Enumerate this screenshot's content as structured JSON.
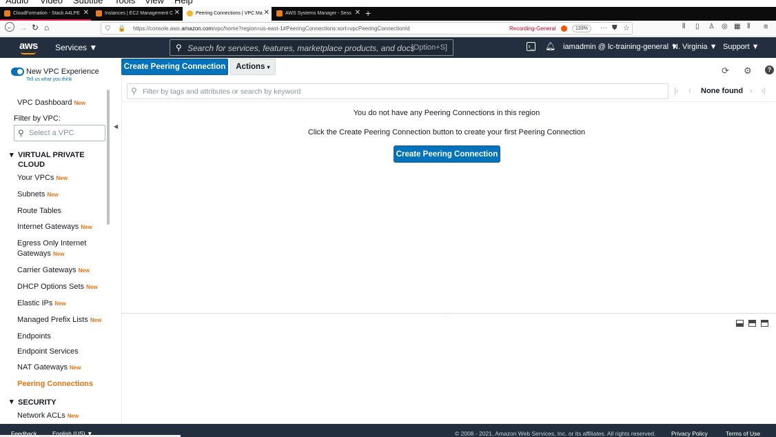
{
  "os_menu": [
    "Audio",
    "Video",
    "Subtitle",
    "Tools",
    "View",
    "Help"
  ],
  "browser": {
    "tabs": [
      {
        "label": "CloudFormation - Stack A4LPE"
      },
      {
        "label": "Instances | EC2 Management C"
      },
      {
        "label": "Peering Connections | VPC Ma"
      },
      {
        "label": "AWS Systems Manager - Sess"
      }
    ],
    "url_prefix": "https://console.aws.",
    "url_domain": "amazon.com",
    "url_suffix": "/vpc/home?region=us-east-1#PeeringConnections:sort=vpcPeeringConnectionId",
    "recording_label": "Recording-General",
    "zoom": "133%"
  },
  "aws_nav": {
    "logo": "aws",
    "services_label": "Services ▼",
    "search_placeholder": "Search for services, features, marketplace products, and docs",
    "search_shortcut": "[Option+S]",
    "account": "iamadmin @ lc-training-general ▼",
    "region": "N. Virginia ▼",
    "support": "Support ▼"
  },
  "sidebar": {
    "new_experience": "New VPC Experience",
    "tell_us": "Tell us what you think",
    "dashboard": "VPC Dashboard",
    "new_badge": "New",
    "filter_label": "Filter by VPC:",
    "vpc_select_placeholder": "Select a VPC",
    "section_vpc": "VIRTUAL PRIVATE CLOUD",
    "items": [
      {
        "label": "Your VPCs",
        "new": "New"
      },
      {
        "label": "Subnets",
        "new": "New"
      },
      {
        "label": "Route Tables",
        "new": ""
      },
      {
        "label": "Internet Gateways",
        "new": "New"
      },
      {
        "label": "Egress Only Internet Gateways",
        "new": "New"
      },
      {
        "label": "Carrier Gateways",
        "new": "New"
      },
      {
        "label": "DHCP Options Sets",
        "new": "New"
      },
      {
        "label": "Elastic IPs",
        "new": "New"
      },
      {
        "label": "Managed Prefix Lists",
        "new": "New"
      },
      {
        "label": "Endpoints",
        "new": ""
      },
      {
        "label": "Endpoint Services",
        "new": ""
      },
      {
        "label": "NAT Gateways",
        "new": "New"
      },
      {
        "label": "Peering Connections",
        "new": ""
      }
    ],
    "section_security": "SECURITY",
    "security_items": [
      {
        "label": "Network ACLs",
        "new": "New"
      }
    ]
  },
  "main": {
    "create_button": "Create Peering Connection",
    "actions_button": "Actions",
    "filter_placeholder": "Filter by tags and attributes or search by keyword",
    "pager_status": "None found",
    "empty_title": "You do not have any Peering Connections in this region",
    "empty_hint": "Click the Create Peering Connection button to create your first Peering Connection",
    "empty_create_button": "Create Peering Connection"
  },
  "footer": {
    "feedback": "Feedback",
    "language": "English (US) ▼",
    "copyright": "© 2008 - 2021, Amazon Web Services, Inc. or its affiliates. All rights reserved.",
    "privacy": "Privacy Policy",
    "terms": "Terms of Use"
  },
  "colors": {
    "aws_nav_bg": "#232f3e",
    "primary_button": "#0073bb",
    "active_item": "#ec7211",
    "new_badge": "#ec7211"
  }
}
